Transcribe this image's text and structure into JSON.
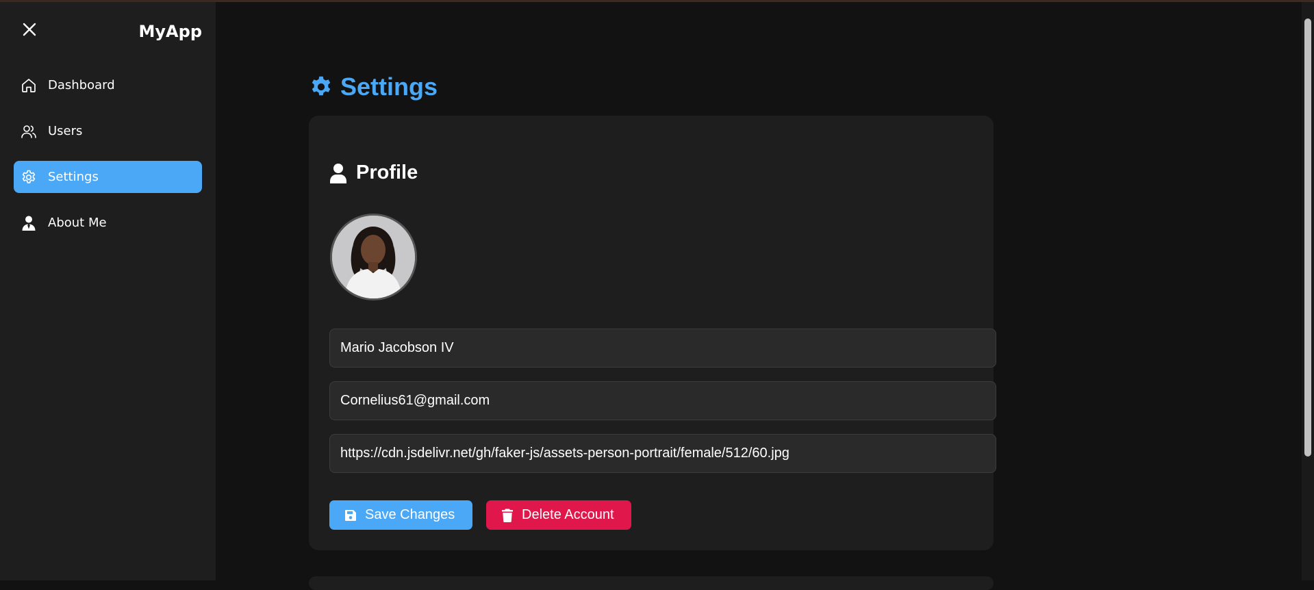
{
  "app": {
    "title": "MyApp"
  },
  "sidebar": {
    "items": [
      {
        "label": "Dashboard",
        "icon": "home-icon",
        "active": false
      },
      {
        "label": "Users",
        "icon": "users-icon",
        "active": false
      },
      {
        "label": "Settings",
        "icon": "gear-icon",
        "active": true
      },
      {
        "label": "About Me",
        "icon": "user-tie-icon",
        "active": false
      }
    ]
  },
  "page": {
    "title": "Settings",
    "title_icon": "gear-icon"
  },
  "profile": {
    "section_title": "Profile",
    "section_icon": "user-icon",
    "name_value": "Mario Jacobson IV",
    "email_value": "Cornelius61@gmail.com",
    "avatar_url_value": "https://cdn.jsdelivr.net/gh/faker-js/assets-person-portrait/female/512/60.jpg",
    "save_label": "Save Changes",
    "delete_label": "Delete Account"
  },
  "colors": {
    "accent": "#4aa8f6",
    "danger": "#e0174a",
    "sidebar_bg": "#1e1e1e",
    "page_bg": "#121212",
    "card_bg": "#1e1e1e"
  }
}
